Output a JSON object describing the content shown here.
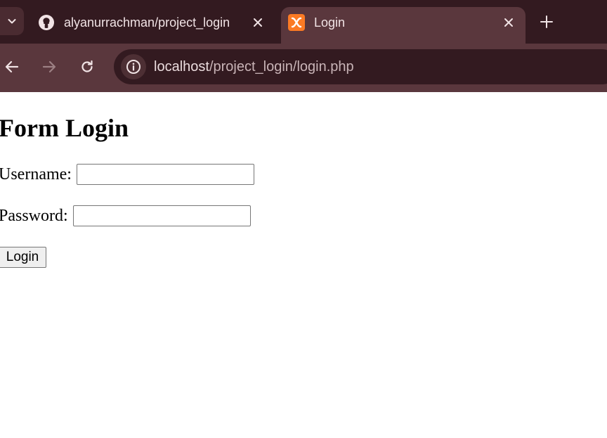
{
  "browser": {
    "tabs": [
      {
        "title": "alyanurrachman/project_login",
        "icon": "github-icon",
        "active": false
      },
      {
        "title": "Login",
        "icon": "xampp-icon",
        "active": true
      }
    ],
    "url_host": "localhost",
    "url_path": "/project_login/login.php",
    "colors": {
      "tabstrip": "#331a20",
      "toolbar": "#5a373d",
      "omnibox": "#331a20"
    }
  },
  "page": {
    "heading": "Form Login",
    "username_label": "Username:",
    "username_value": "",
    "password_label": "Password:",
    "password_value": "",
    "login_button": "Login"
  }
}
